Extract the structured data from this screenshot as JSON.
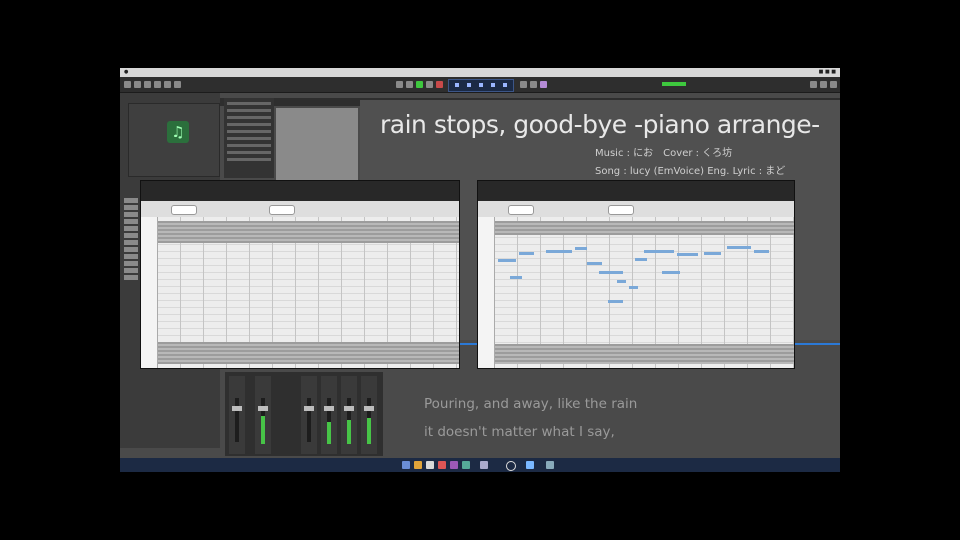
{
  "colors": {
    "accent": "#2b79d6",
    "note": "#7aa8d8",
    "meter": "#3ec83e",
    "background": "#4a4a4a"
  },
  "icons": {
    "track_art": "music-note-icon"
  },
  "overlay": {
    "title": "rain stops, good-bye -piano arrange-",
    "credits_line1": "Music : にお　Cover : くろ坊",
    "credits_line2": "Song : lucy (EmVoice)  Eng. Lyric : まど",
    "lyric_line1": "Pouring, and away, like the rain",
    "lyric_line2": "it doesn't matter what I say,"
  },
  "editors": [
    {
      "id": "left",
      "notes": []
    },
    {
      "id": "right",
      "notes": [
        {
          "x": 0.01,
          "lane": 0.28,
          "w": 0.06
        },
        {
          "x": 0.08,
          "lane": 0.23,
          "w": 0.05
        },
        {
          "x": 0.17,
          "lane": 0.22,
          "w": 0.09
        },
        {
          "x": 0.27,
          "lane": 0.2,
          "w": 0.04
        },
        {
          "x": 0.31,
          "lane": 0.3,
          "w": 0.05
        },
        {
          "x": 0.35,
          "lane": 0.36,
          "w": 0.08
        },
        {
          "x": 0.47,
          "lane": 0.27,
          "w": 0.04
        },
        {
          "x": 0.5,
          "lane": 0.22,
          "w": 0.1
        },
        {
          "x": 0.61,
          "lane": 0.24,
          "w": 0.07
        },
        {
          "x": 0.7,
          "lane": 0.23,
          "w": 0.06
        },
        {
          "x": 0.78,
          "lane": 0.19,
          "w": 0.08
        },
        {
          "x": 0.87,
          "lane": 0.22,
          "w": 0.05
        },
        {
          "x": 0.05,
          "lane": 0.39,
          "w": 0.04
        },
        {
          "x": 0.41,
          "lane": 0.42,
          "w": 0.03
        },
        {
          "x": 0.45,
          "lane": 0.46,
          "w": 0.03
        },
        {
          "x": 0.38,
          "lane": 0.55,
          "w": 0.05
        },
        {
          "x": 0.56,
          "lane": 0.36,
          "w": 0.06
        }
      ]
    }
  ]
}
